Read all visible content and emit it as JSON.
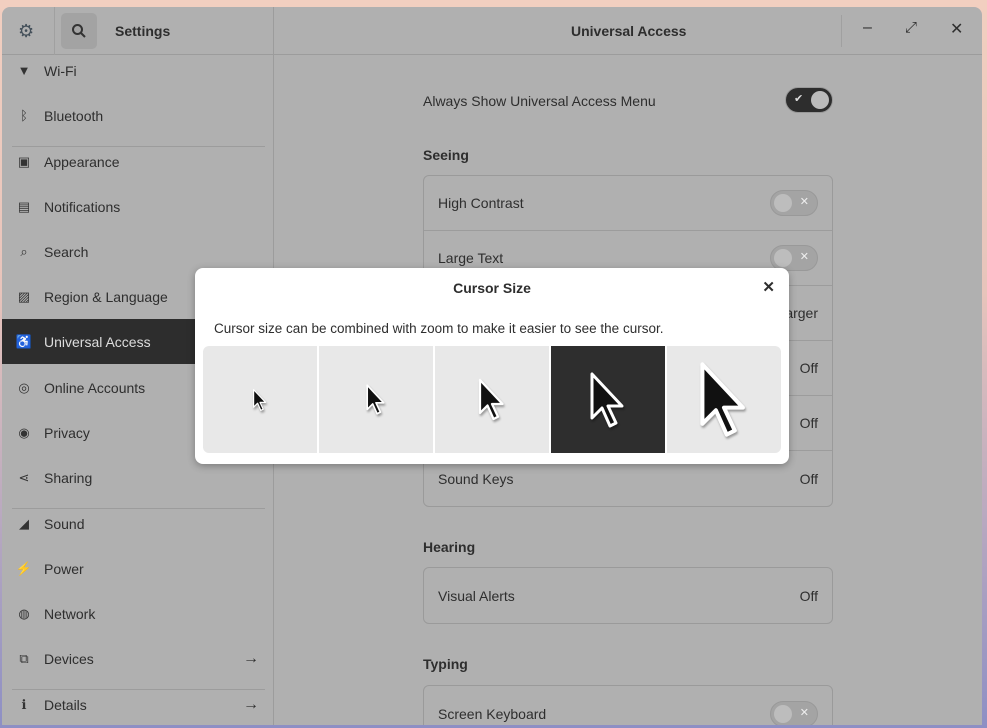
{
  "header": {
    "sidebar_title": "Settings",
    "main_title": "Universal Access"
  },
  "sidebar": {
    "items": [
      {
        "label": "Wi-Fi",
        "icon": "wifi-icon"
      },
      {
        "label": "Bluetooth",
        "icon": "bluetooth-icon"
      },
      {
        "label": "Appearance",
        "icon": "appearance-icon"
      },
      {
        "label": "Notifications",
        "icon": "notifications-icon"
      },
      {
        "label": "Search",
        "icon": "search-icon"
      },
      {
        "label": "Region & Language",
        "icon": "region-icon"
      },
      {
        "label": "Universal Access",
        "icon": "accessibility-icon",
        "selected": true
      },
      {
        "label": "Online Accounts",
        "icon": "online-accounts-icon"
      },
      {
        "label": "Privacy",
        "icon": "privacy-icon"
      },
      {
        "label": "Sharing",
        "icon": "sharing-icon"
      },
      {
        "label": "Sound",
        "icon": "sound-icon"
      },
      {
        "label": "Power",
        "icon": "power-icon"
      },
      {
        "label": "Network",
        "icon": "network-icon"
      },
      {
        "label": "Devices",
        "icon": "devices-icon",
        "arrow": true
      },
      {
        "label": "Details",
        "icon": "details-icon",
        "arrow": true
      }
    ]
  },
  "main": {
    "always_show": {
      "label": "Always Show Universal Access Menu",
      "on": true
    },
    "seeing": {
      "title": "Seeing",
      "rows": [
        {
          "label": "High Contrast",
          "toggle": false
        },
        {
          "label": "Large Text",
          "toggle": false
        },
        {
          "label": "",
          "value": "Larger"
        },
        {
          "label": "",
          "value": "Off"
        },
        {
          "label": "",
          "value": "Off"
        },
        {
          "label": "Sound Keys",
          "value": "Off"
        }
      ]
    },
    "hearing": {
      "title": "Hearing",
      "rows": [
        {
          "label": "Visual Alerts",
          "value": "Off"
        }
      ]
    },
    "typing": {
      "title": "Typing",
      "rows": [
        {
          "label": "Screen Keyboard",
          "toggle": false
        }
      ]
    }
  },
  "dialog": {
    "title": "Cursor Size",
    "description": "Cursor size can be combined with zoom to make it easier to see the cursor.",
    "sizes": 5,
    "selected_index": 3
  }
}
